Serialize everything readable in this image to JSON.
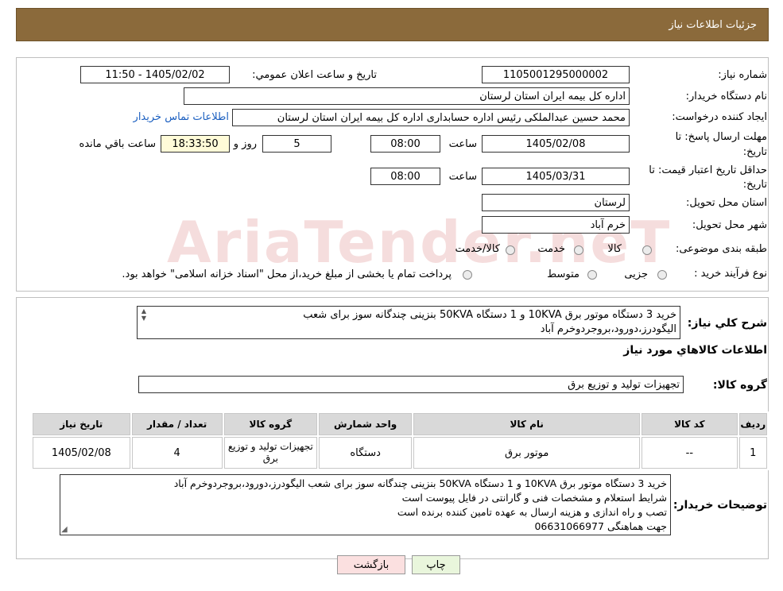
{
  "header": {
    "title": "جزئیات اطلاعات نیاز"
  },
  "form": {
    "need_number_label": "شماره نیاز:",
    "need_number": "1105001295000002",
    "announce_label": "تاریخ و ساعت اعلان عمومي:",
    "announce_value": "1405/02/02 - 11:50",
    "buyer_org_label": "نام دستگاه خريدار:",
    "buyer_org": "اداره کل بیمه ایران استان لرستان",
    "requester_label": "ايجاد کننده درخواست:",
    "requester": "محمد حسین  عبدالملکی  رئیس اداره حسابداری  اداره کل بیمه ایران استان لرستان",
    "contact_link": "اطلاعات تماس خريدار",
    "deadline_label_1": "مهلت ارسال پاسخ: تا",
    "deadline_label_2": "تاریخ:",
    "deadline_date": "1405/02/08",
    "time_label": "ساعت",
    "deadline_time": "08:00",
    "days_value": "5",
    "days_label": "روز و",
    "remaining_time": "18:33:50",
    "remaining_label": "ساعت باقي مانده",
    "validity_label_1": "حداقل تاريخ اعتبار قيمت: تا",
    "validity_label_2": "تاريخ:",
    "validity_date": "1405/03/31",
    "validity_time": "08:00",
    "province_label": "استان محل تحويل:",
    "province": "لرستان",
    "city_label": "شهر محل تحويل:",
    "city": "خرم آباد",
    "category_label": "طبقه بندی موضوعی:",
    "category_options": [
      "کالا",
      "خدمت",
      "کالا/خدمت"
    ],
    "process_label": "نوع فرآیند خرید :",
    "process_options": [
      "جزیی",
      "متوسط"
    ],
    "process_note": "پرداخت تمام يا بخشی از مبلغ خريد،از محل \"اسناد خزانه اسلامی\" خواهد بود."
  },
  "summary": {
    "label": "شرح کلي نياز:",
    "text_line1": "خرید 3 دستگاه موتور برق 10KVA و 1 دستگاه 50KVA بنزینی چندگانه سوز برای شعب",
    "text_line2": "الیگودرز،دورود،بروجردوخرم آباد",
    "goods_info_title": "اطلاعات کالاهاي مورد نياز",
    "goods_group_label": "گروه کالا:",
    "goods_group": "تجهیزات تولید و توزیع برق"
  },
  "table": {
    "headers": [
      "رديف",
      "کد کالا",
      "نام کالا",
      "واحد شمارش",
      "گروه کالا",
      "تعداد / مقدار",
      "تاريخ نياز"
    ],
    "rows": [
      [
        "1",
        "--",
        "موتور برق",
        "دستگاه",
        "تجهیزات تولید و توزیع برق",
        "4",
        "1405/02/08"
      ]
    ]
  },
  "buyer_notes": {
    "label": "توضيحات خريدار:",
    "lines": [
      "خرید 3 دستگاه موتور برق 10KVA و 1 دستگاه 50KVA بنزینی چندگانه سوز برای شعب الیگودرز،دورود،بروجردوخرم آباد",
      "شرایط استعلام و مشخصات فنی و گارانتی در فایل پیوست است",
      "تصب و راه اندازی و هزینه ارسال به عهده تامین کننده برنده است",
      "جهت هماهنگی 06631066977"
    ]
  },
  "buttons": {
    "print": "چاپ",
    "back": "بازگشت"
  },
  "watermark": {
    "text": "AriaTender.neT"
  },
  "colors": {
    "header": "#8b6a3b",
    "link": "#1b5fc0",
    "yellow_box": "#fffbd8",
    "print_btn": "#e9f6dc",
    "back_btn": "#fbe0e0"
  }
}
